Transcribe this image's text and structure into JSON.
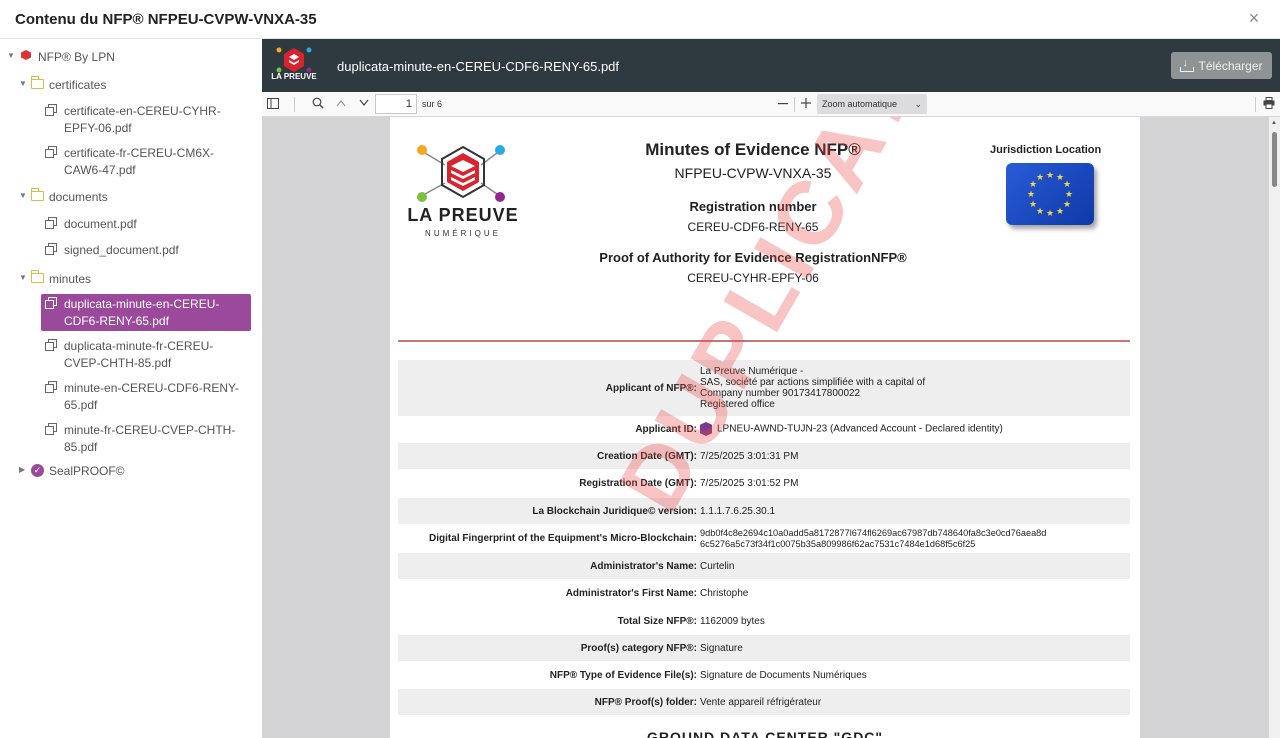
{
  "modal": {
    "title": "Contenu du NFP® NFPEU-CVPW-VNXA-35",
    "close_glyph": "×"
  },
  "tree": {
    "root": "NFP® By LPN",
    "folders": [
      {
        "name": "certificates",
        "files": [
          "certificate-en-CEREU-CYHR-EPFY-06.pdf",
          "certificate-fr-CEREU-CM6X-CAW6-47.pdf"
        ]
      },
      {
        "name": "documents",
        "files": [
          "document.pdf",
          "signed_document.pdf"
        ]
      },
      {
        "name": "minutes",
        "files": [
          "duplicata-minute-en-CEREU-CDF6-RENY-65.pdf",
          "duplicata-minute-fr-CEREU-CVEP-CHTH-85.pdf",
          "minute-en-CEREU-CDF6-RENY-65.pdf",
          "minute-fr-CEREU-CVEP-CHTH-85.pdf"
        ]
      }
    ],
    "seal": "SealPROOF©"
  },
  "viewer": {
    "logo_text": "LA PREUVE",
    "file_title": "duplicata-minute-en-CEREU-CDF6-RENY-65.pdf",
    "download_label": "Télécharger",
    "page_number": "1",
    "page_of": "sur 6",
    "zoom": "Zoom automatique"
  },
  "pdf": {
    "logo_text": "LA PREUVE",
    "logo_sub": "NUMÉRIQUE",
    "title": "Minutes of Evidence NFP®",
    "nfp_id": "NFPEU-CVPW-VNXA-35",
    "reg_label": "Registration number",
    "reg_value": "CEREU-CDF6-RENY-65",
    "poa_label": "Proof of Authority for Evidence RegistrationNFP®",
    "poa_value": "CEREU-CYHR-EPFY-06",
    "jurisdiction_label": "Jurisdiction Location",
    "watermark": "DUPLICATA",
    "rows": {
      "applicant_label": "Applicant of NFP®:",
      "applicant_lines": [
        "La Preuve Numérique -",
        "SAS, société par actions simplifiée with a capital of",
        "Company number 90173417800022",
        "Registered office"
      ],
      "applicant_id_label": "Applicant ID:",
      "applicant_id_value": "LPNEU-AWND-TUJN-23 (Advanced Account - Declared identity)",
      "creation_label": "Creation Date (GMT):",
      "creation_value": "7/25/2025 3:01:31 PM",
      "registration_label": "Registration Date (GMT):",
      "registration_value": "7/25/2025 3:01:52 PM",
      "blockchain_label": "La Blockchain Juridique© version:",
      "blockchain_value": "1.1.1.7.6.25.30.1",
      "fingerprint_label": "Digital Fingerprint of the Equipment's Micro-Blockchain:",
      "fingerprint_line1": "9db0f4c8e2694c10a0add5a8172877l674fl6269ac67987db748640fa8c3e0cd76aea8d",
      "fingerprint_line2": "6c5276a5c73f34f1c0075b35a809986f62ac7531c7484e1d68f5c6f25",
      "admin_name_label": "Administrator's Name:",
      "admin_name_value": "Curtelin",
      "admin_first_label": "Administrator's First Name:",
      "admin_first_value": "Christophe",
      "size_label": "Total Size NFP®:",
      "size_value": "1162009 bytes",
      "category_label": "Proof(s) category NFP®:",
      "category_value": "Signature",
      "type_label": "NFP® Type of Evidence File(s):",
      "type_value": "Signature de Documents Numériques",
      "folder_label": "NFP® Proof(s) folder:",
      "folder_value": "Vente appareil réfrigérateur"
    },
    "bottom_heading": "GROUND DATA CENTER \"GDC\""
  },
  "colors": {
    "selected": "#9b4a9b",
    "viewer_header": "#2f3a40",
    "watermark": "#e84646"
  },
  "icons": [
    "close-icon",
    "folder-icon",
    "file-icon",
    "seal-icon",
    "download-icon",
    "sidebar-toggle-icon",
    "search-icon",
    "chevron-up-icon",
    "chevron-down-icon",
    "zoom-out-icon",
    "zoom-in-icon",
    "print-icon"
  ]
}
